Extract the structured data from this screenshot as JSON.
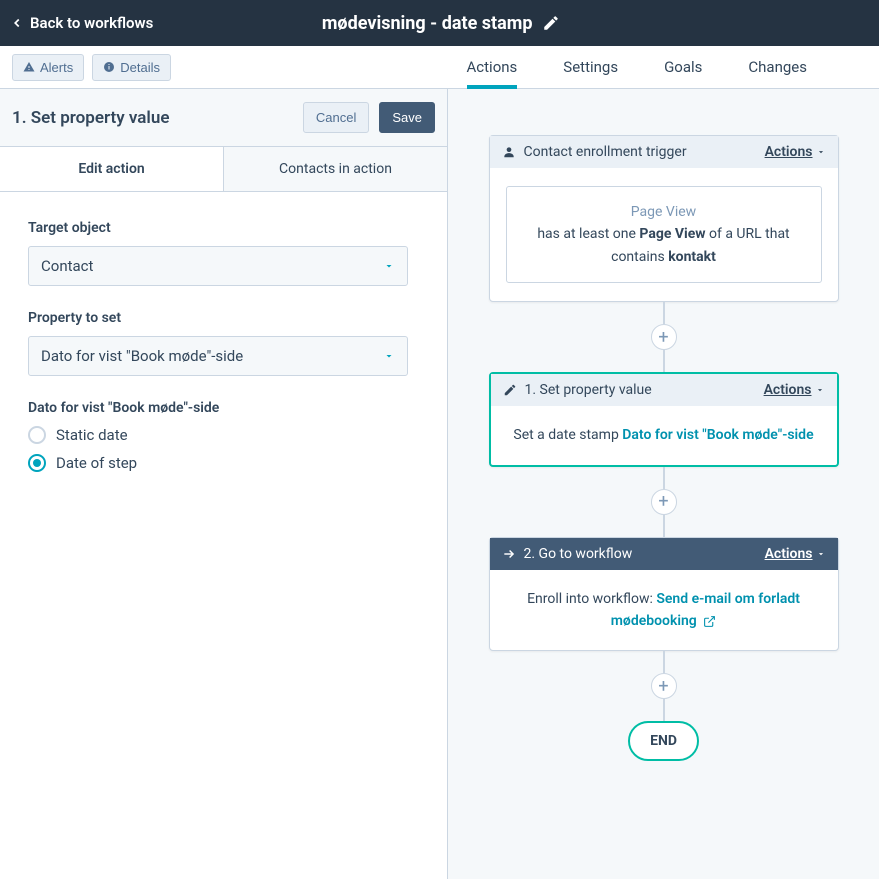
{
  "topbar": {
    "back_label": "Back to workflows",
    "title": "mødevisning - date stamp"
  },
  "toolbar": {
    "alerts_label": "Alerts",
    "details_label": "Details",
    "tabs": {
      "actions": "Actions",
      "settings": "Settings",
      "goals": "Goals",
      "changes": "Changes"
    }
  },
  "panel": {
    "heading": "1. Set property value",
    "cancel_label": "Cancel",
    "save_label": "Save",
    "subtabs": {
      "edit": "Edit action",
      "contacts": "Contacts in action"
    }
  },
  "form": {
    "target_object_label": "Target object",
    "target_object_value": "Contact",
    "property_label": "Property to set",
    "property_value": "Dato for vist \"Book møde\"-side",
    "value_type_label": "Dato for vist \"Book møde\"-side",
    "radios": {
      "static": "Static date",
      "step": "Date of step"
    },
    "selected_radio": "step"
  },
  "workflow": {
    "actions_label": "Actions",
    "trigger": {
      "title": "Contact enrollment trigger",
      "inner_heading": "Page View",
      "body_prefix": "has at least one ",
      "body_bold1": "Page View",
      "body_mid": " of a URL that contains ",
      "body_bold2": "kontakt"
    },
    "step1": {
      "title": "1. Set property value",
      "body_prefix": "Set a date stamp ",
      "body_link": "Dato for vist \"Book møde\"-side"
    },
    "step2": {
      "title": "2. Go to workflow",
      "body_prefix": "Enroll into workflow: ",
      "body_link": "Send e-mail om forladt mødebooking"
    },
    "end_label": "END"
  }
}
